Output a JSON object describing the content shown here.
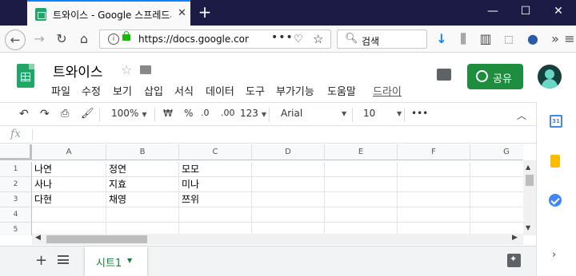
{
  "browser": {
    "tab_title": "트와이스 - Google 스프레드시",
    "tab_close": "✕",
    "new_tab": "+",
    "url": "https://docs.google.com",
    "search_placeholder": "검색",
    "window_controls": [
      "—",
      "☐",
      "✕"
    ]
  },
  "doc": {
    "title": "트와이스",
    "star": "☆",
    "menu": [
      "파일",
      "수정",
      "보기",
      "삽입",
      "서식",
      "데이터",
      "도구",
      "부가기능",
      "도움말",
      "드라이"
    ],
    "share_label": "공유"
  },
  "toolbar": {
    "zoom": "100%",
    "currency": "₩",
    "percent": "%",
    "decimal_decrease": ".0",
    "decimal_increase": ".00",
    "number_format": "123",
    "font": "Arial",
    "font_size": "10",
    "more": "•••"
  },
  "formula_bar": {
    "fx": "fx"
  },
  "grid": {
    "columns": [
      "A",
      "B",
      "C",
      "D",
      "E",
      "F",
      "G"
    ],
    "rows": [
      "1",
      "2",
      "3",
      "4",
      "5"
    ],
    "cells": [
      [
        "나연",
        "정연",
        "모모"
      ],
      [
        "사나",
        "지효",
        "미나"
      ],
      [
        "다현",
        "채영",
        "쯔위"
      ]
    ]
  },
  "sheets": {
    "add": "+",
    "active_tab": "시트1"
  },
  "side_panel": {
    "calendar_label": "31"
  },
  "colors": {
    "brand_green": "#23a566",
    "share_green": "#1e8e3e",
    "browser_dark": "#1c1b46",
    "accent_blue": "#0a84ff"
  }
}
